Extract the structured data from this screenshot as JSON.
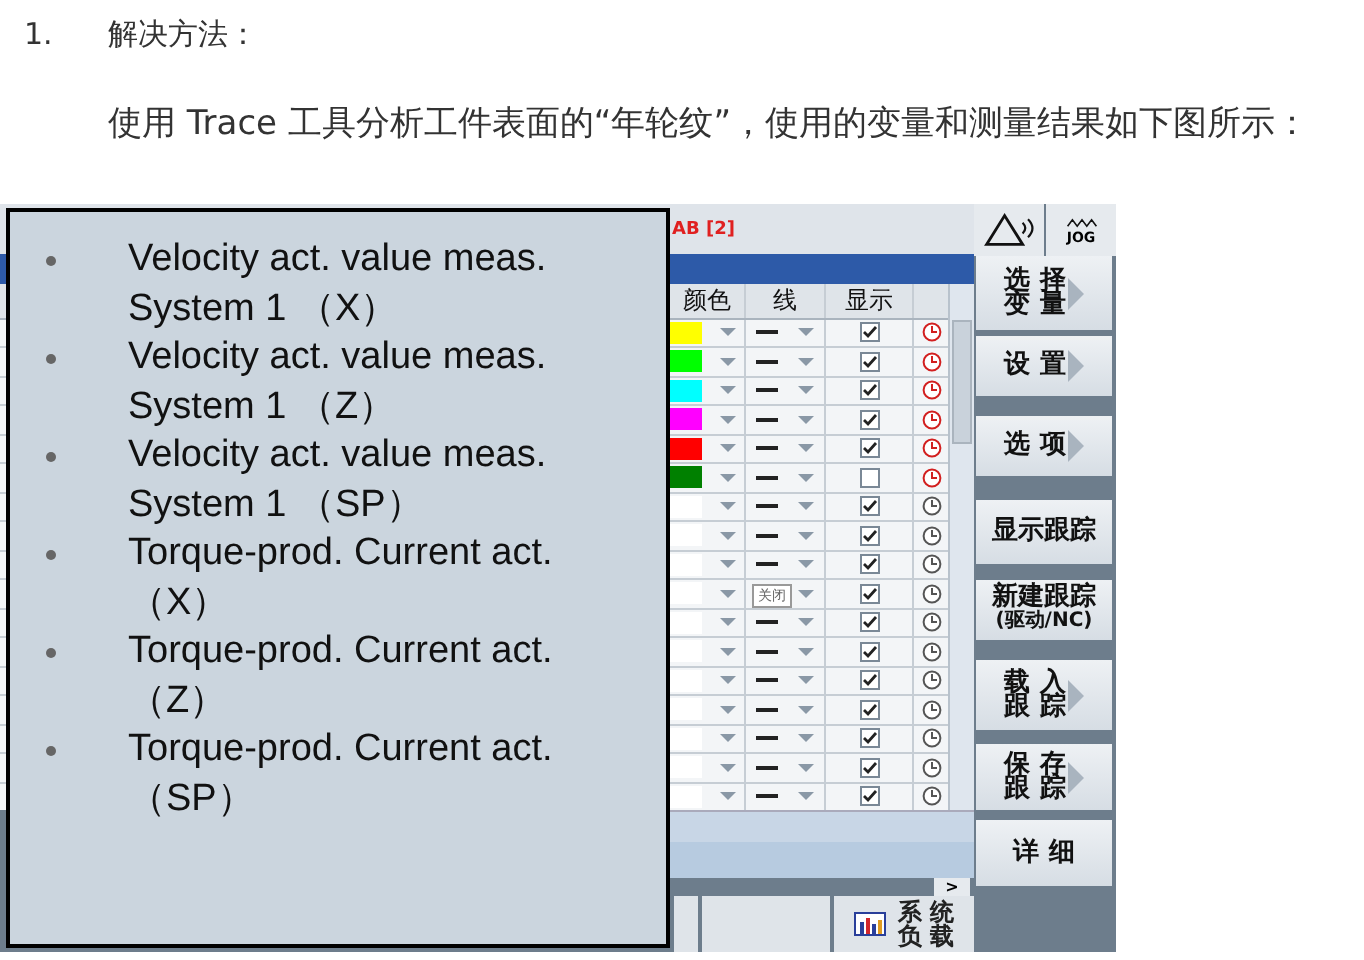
{
  "heading": {
    "number": "1.",
    "text": "解决方法："
  },
  "paragraph": "使用 Trace 工具分析工件表面的“年轮纹”，使用的变量和测量结果如下图所示：",
  "hmi": {
    "header_label": "AB [2]",
    "jog_label": "JOG",
    "columns": [
      "颜色",
      "线",
      "显示"
    ],
    "rows": [
      {
        "color": "#ffff00",
        "shown": true,
        "triggered": true
      },
      {
        "color": "#00ff00",
        "shown": true,
        "triggered": true
      },
      {
        "color": "#00ffff",
        "shown": true,
        "triggered": true
      },
      {
        "color": "#ff00ff",
        "shown": true,
        "triggered": true
      },
      {
        "color": "#ff0000",
        "shown": true,
        "triggered": true
      },
      {
        "color": "#008000",
        "shown": false,
        "triggered": true
      },
      {
        "color": "#ffffff",
        "shown": true,
        "triggered": false
      },
      {
        "color": "#ffffff",
        "shown": true,
        "triggered": false
      },
      {
        "color": "#ffffff",
        "shown": true,
        "triggered": false
      },
      {
        "color": "#ffffff",
        "shown": true,
        "triggered": false,
        "tooltip": "关闭"
      },
      {
        "color": "#ffffff",
        "shown": true,
        "triggered": false
      },
      {
        "color": "#ffffff",
        "shown": true,
        "triggered": false
      },
      {
        "color": "#ffffff",
        "shown": true,
        "triggered": false
      },
      {
        "color": "#ffffff",
        "shown": true,
        "triggered": false
      },
      {
        "color": "#ffffff",
        "shown": true,
        "triggered": false
      },
      {
        "color": "#ffffff",
        "shown": true,
        "triggered": false
      },
      {
        "color": "#ffffff",
        "shown": true,
        "triggered": false
      }
    ],
    "softkeys": [
      {
        "lines": [
          "选 择",
          "变 量"
        ],
        "arrow": true
      },
      {
        "lines": [
          "设 置"
        ],
        "arrow": true
      },
      {
        "lines": [
          "选 项"
        ],
        "arrow": true
      },
      {
        "lines": [
          "显示跟踪"
        ],
        "arrow": false
      },
      {
        "lines": [
          "新建跟踪",
          "(驱动/NC)"
        ],
        "arrow": false
      },
      {
        "lines": [
          "载 入",
          "跟 踪"
        ],
        "arrow": true
      },
      {
        "lines": [
          "保 存",
          "跟 踪"
        ],
        "arrow": true
      },
      {
        "lines": [
          "详 细"
        ],
        "arrow": false
      }
    ],
    "scroll_right": ">",
    "load_button": [
      "系 统",
      "负 载"
    ]
  },
  "overlay_items": [
    "Velocity act. value meas. System 1 （X）",
    "Velocity act. value meas. System 1 （Z）",
    "Velocity act. value meas. System 1 （SP）",
    "Torque-prod. Current act. （X）",
    "Torque-prod. Current act. （Z）",
    "Torque-prod. Current act. （SP）"
  ]
}
